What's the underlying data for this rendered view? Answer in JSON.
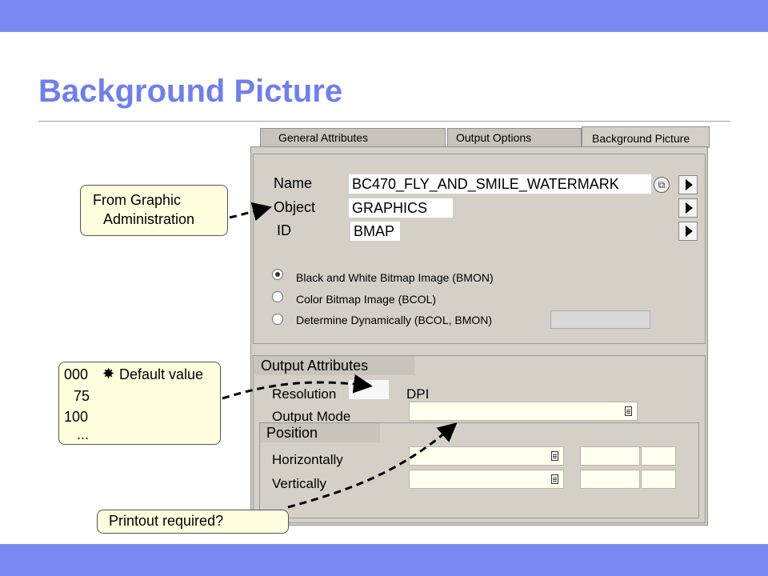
{
  "slide": {
    "title": "Background Picture"
  },
  "tabs": [
    {
      "label": "General Attributes"
    },
    {
      "label": "Output Options"
    },
    {
      "label": "Background Picture"
    }
  ],
  "fields": {
    "name": {
      "label": "Name",
      "value": "BC470_FLY_AND_SMILE_WATERMARK"
    },
    "object": {
      "label": "Object",
      "value": "GRAPHICS"
    },
    "id": {
      "label": "ID",
      "value": "BMAP"
    }
  },
  "radio_options": [
    {
      "label": "Black and White Bitmap Image (BMON)",
      "checked": true
    },
    {
      "label": "Color Bitmap Image (BCOL)",
      "checked": false
    },
    {
      "label": "Determine Dynamically (BCOL, BMON)",
      "checked": false
    }
  ],
  "output_attributes": {
    "header": "Output Attributes",
    "resolution_label": "Resolution",
    "resolution_unit": "DPI",
    "output_mode_label": "Output Mode"
  },
  "position": {
    "header": "Position",
    "horizontal_label": "Horizontally",
    "vertical_label": "Vertically"
  },
  "callouts": {
    "graphic_admin_line1": "From Graphic",
    "graphic_admin_line2": "Administration",
    "dpi_values": [
      "000",
      "75",
      "100",
      "..."
    ],
    "default_marker": "✸",
    "default_value": "Default value",
    "printout": "Printout required?"
  },
  "colors": {
    "band": "#7b88f2",
    "title": "#6f7ff0",
    "panel": "#d4d0c8",
    "callout_fill": "#ffffde"
  }
}
